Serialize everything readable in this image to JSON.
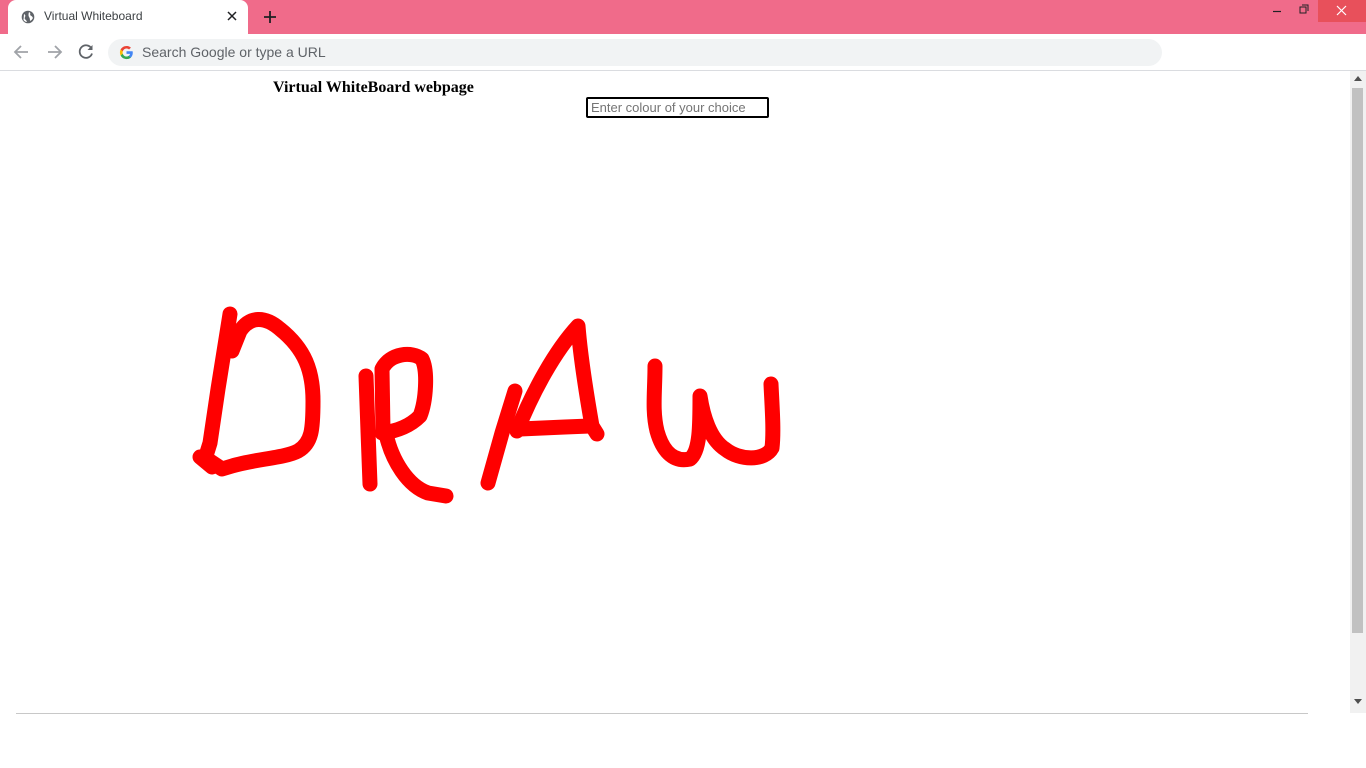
{
  "browser": {
    "tab_title": "Virtual Whiteboard",
    "omnibox_placeholder": "Search Google or type a URL",
    "accent_color": "#f06b8a"
  },
  "page": {
    "title": "Virtual WhiteBoard webpage",
    "colour_input": {
      "placeholder": "Enter colour of your choice",
      "value": ""
    }
  },
  "whiteboard": {
    "drawing_text": "DRAW",
    "stroke_color": "#ff0000"
  },
  "icons": {
    "tab_favicon": "globe-icon",
    "tab_close": "close-icon",
    "new_tab": "plus-icon",
    "back": "arrow-left-icon",
    "forward": "arrow-right-icon",
    "reload": "reload-icon",
    "search_engine": "google-icon",
    "minimize": "minimize-icon",
    "maximize": "restore-icon",
    "close_window": "close-icon"
  }
}
